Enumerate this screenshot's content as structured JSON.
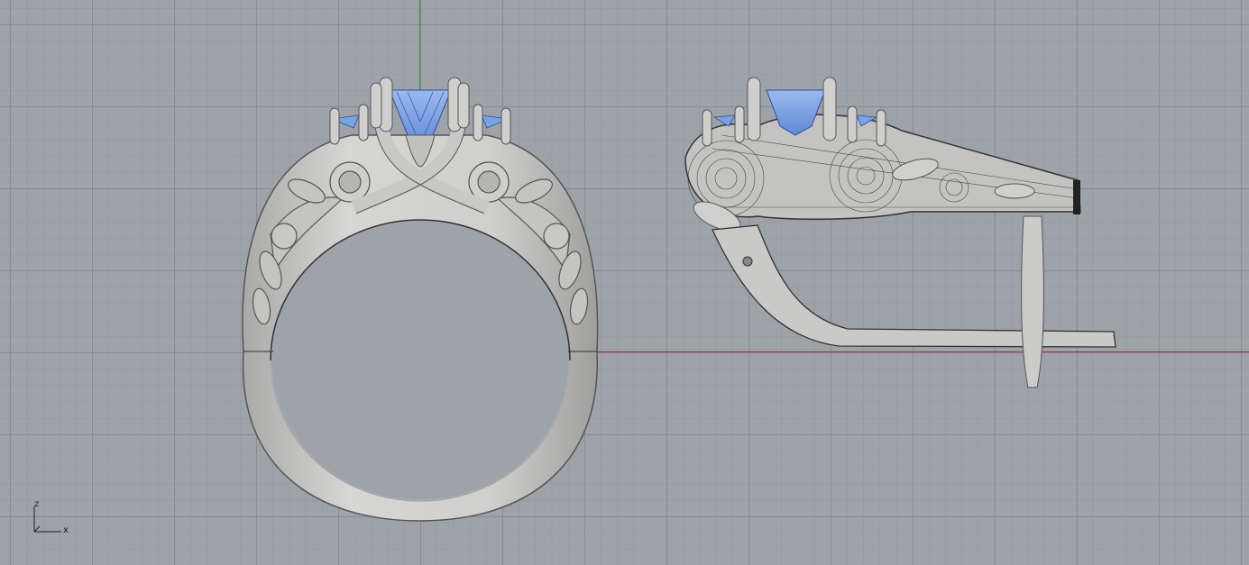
{
  "viewport": {
    "view": "Front",
    "background": "#9ea3aa",
    "grid_color": "#7e848b",
    "x_axis_color": "#b42828",
    "y_axis_color": "#1f9e2a"
  },
  "model": {
    "metal_color": "#c9c9c7",
    "stone_color": "#7aa2e6",
    "wire_color": "#222222"
  },
  "axes_gizmo": {
    "z_label": "z",
    "x_label": "x"
  }
}
